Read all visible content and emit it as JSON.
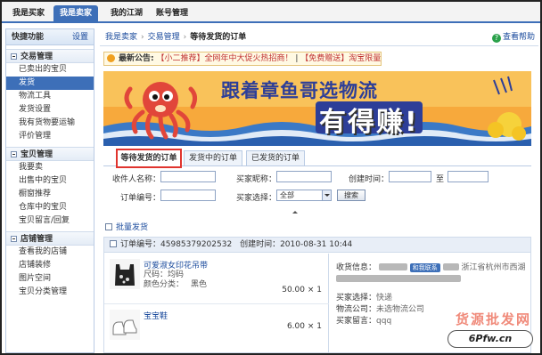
{
  "topnav": {
    "tabs": [
      {
        "label": "我是买家"
      },
      {
        "label": "我是卖家"
      },
      {
        "label": "我的江湖"
      },
      {
        "label": "账号管理"
      }
    ]
  },
  "sidebar": {
    "title": "快捷功能",
    "settings": "设置",
    "sections": [
      {
        "title": "交易管理",
        "items": [
          "已卖出的宝贝",
          "发货",
          "物流工具",
          "发货设置",
          "我有货物要运输",
          "评价管理"
        ]
      },
      {
        "title": "宝贝管理",
        "items": [
          "我要卖",
          "出售中的宝贝",
          "橱窗推荐",
          "仓库中的宝贝",
          "宝贝留言/回复"
        ]
      },
      {
        "title": "店铺管理",
        "items": [
          "查看我的店铺",
          "店铺装修",
          "图片空间",
          "宝贝分类管理"
        ]
      }
    ]
  },
  "breadcrumb": {
    "home": "我是卖家",
    "section": "交易管理",
    "current": "等待发货的订单"
  },
  "help": "查看帮助",
  "notice": {
    "label": "最新公告:",
    "item1": "【小二推荐】全网年中大促火热招商！",
    "divider": "|",
    "item2": "【免费赠送】淘宝限量蚂蚁公仔！"
  },
  "banner": {
    "title": "跟着章鱼哥选物流",
    "subtitle": "有得赚!"
  },
  "tabs": [
    {
      "label": "等待发货的订单"
    },
    {
      "label": "发货中的订单"
    },
    {
      "label": "已发货的订单"
    }
  ],
  "search": {
    "recipient_label": "收件人名称：",
    "buyer_label": "买家昵称：",
    "created_label": "创建时间：",
    "to_label": "至",
    "order_no_label": "订单编号：",
    "buyer_choice_label": "买家选择：",
    "buyer_choice_value": "全部",
    "button": "搜索"
  },
  "batch": "批量发货",
  "order": {
    "number_label": "订单编号：",
    "number": "45985379202532",
    "created_label": "创建时间：",
    "created": "2010-08-31 10:44",
    "items": [
      {
        "name": "可爱淑女印花吊带",
        "size_label": "尺码：",
        "size": "均码",
        "color_label": "颜色分类：",
        "color": "黑色",
        "price": "50.00",
        "qty": "× 1"
      },
      {
        "name": "宝宝鞋",
        "price": "6.00",
        "qty": "× 1"
      }
    ],
    "receiver_label": "收货信息：",
    "talk": "和我联系",
    "address": "浙江省杭州市西湖",
    "shipping_label": "买家选择：",
    "shipping": "快递",
    "company_label": "物流公司：",
    "company": "未选物流公司",
    "message_label": "买家留言：",
    "message": "qqq"
  },
  "watermark": {
    "text": "货源批发网",
    "logo": "6Pfw.cn"
  }
}
